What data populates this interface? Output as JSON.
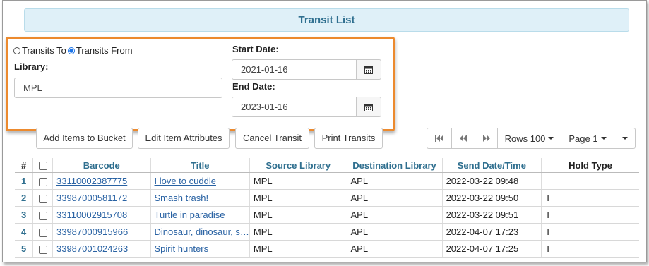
{
  "header": {
    "title": "Transit List"
  },
  "filters": {
    "radio_to_label": "Transits To",
    "radio_from_label": "Transits From",
    "selected": "from",
    "library_label": "Library:",
    "library_value": "MPL",
    "start_label": "Start Date:",
    "start_value": "2021-01-16",
    "end_label": "End Date:",
    "end_value": "2023-01-16"
  },
  "actions": {
    "add_bucket": "Add Items to Bucket",
    "edit_attrs": "Edit Item Attributes",
    "cancel_transit": "Cancel Transit",
    "print_transits": "Print Transits"
  },
  "pager": {
    "rows_label": "Rows 100",
    "page_label": "Page 1"
  },
  "table": {
    "columns": [
      "#",
      "",
      "Barcode",
      "Title",
      "Source Library",
      "Destination Library",
      "Send Date/Time",
      "Hold Type"
    ],
    "rows": [
      {
        "num": "1",
        "barcode": "33110002387775",
        "title": "I love to cuddle",
        "source": "MPL",
        "dest": "APL",
        "sent": "2022-03-22 09:48",
        "hold": ""
      },
      {
        "num": "2",
        "barcode": "33987000581172",
        "title": "Smash trash!",
        "source": "MPL",
        "dest": "APL",
        "sent": "2022-03-22 09:50",
        "hold": "T"
      },
      {
        "num": "3",
        "barcode": "33110002915708",
        "title": "Turtle in paradise",
        "source": "MPL",
        "dest": "APL",
        "sent": "2022-03-22 09:51",
        "hold": "T"
      },
      {
        "num": "4",
        "barcode": "33987000915966",
        "title": "Dinosaur, dinosaur, s…",
        "source": "MPL",
        "dest": "APL",
        "sent": "2022-04-07 17:23",
        "hold": "T"
      },
      {
        "num": "5",
        "barcode": "33987001024263",
        "title": "Spirit hunters",
        "source": "MPL",
        "dest": "APL",
        "sent": "2022-04-07 17:25",
        "hold": "T"
      }
    ]
  },
  "colors": {
    "accent": "#2f6f8f",
    "highlight": "#ec8a2e",
    "link": "#2962a3"
  }
}
